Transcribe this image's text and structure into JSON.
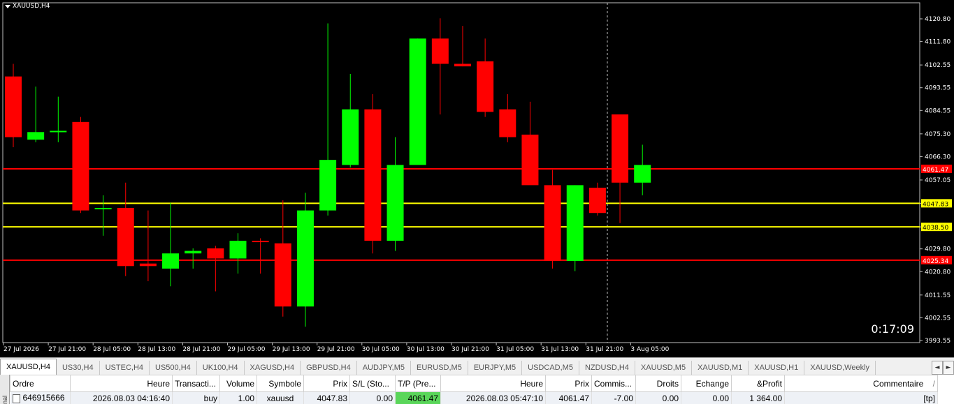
{
  "chart": {
    "symbol": "XAUUSD,H4",
    "timer": "0:17:09",
    "price_axis": [
      "4120.80",
      "4111.80",
      "4102.55",
      "4093.55",
      "4084.55",
      "4075.30",
      "4066.30",
      "4057.05",
      "4047.83",
      "4038.50",
      "4029.80",
      "4020.80",
      "4011.55",
      "4002.55",
      "3993.55"
    ],
    "time_axis": [
      "27 Jul 2026",
      "27 Jul 21:00",
      "28 Jul 05:00",
      "28 Jul 13:00",
      "28 Jul 21:00",
      "29 Jul 05:00",
      "29 Jul 13:00",
      "29 Jul 21:00",
      "30 Jul 05:00",
      "30 Jul 13:00",
      "30 Jul 21:00",
      "31 Jul 05:00",
      "31 Jul 13:00",
      "31 Jul 21:00",
      "3 Aug 05:00"
    ],
    "levels": [
      {
        "price": 4061.47,
        "label": "4061.47",
        "color": "#ff0000"
      },
      {
        "price": 4047.83,
        "label": "4047.83",
        "color": "#ffff00"
      },
      {
        "price": 4038.5,
        "label": "4038.50",
        "color": "#ffff00"
      },
      {
        "price": 4025.34,
        "label": "4025.34",
        "color": "#ff0000"
      }
    ],
    "bull_color": "#00ff00",
    "bear_color": "#ff0000",
    "candles": [
      {
        "o": 4098,
        "h": 4103,
        "l": 4070,
        "c": 4074
      },
      {
        "o": 4073,
        "h": 4094,
        "l": 4072,
        "c": 4076
      },
      {
        "o": 4076,
        "h": 4090,
        "l": 4072,
        "c": 4076.5
      },
      {
        "o": 4080,
        "h": 4082,
        "l": 4044,
        "c": 4045
      },
      {
        "o": 4046,
        "h": 4051,
        "l": 4035,
        "c": 4046
      },
      {
        "o": 4046,
        "h": 4056,
        "l": 4019,
        "c": 4023
      },
      {
        "o": 4024,
        "h": 4045,
        "l": 4017,
        "c": 4023
      },
      {
        "o": 4022,
        "h": 4048,
        "l": 4015,
        "c": 4028
      },
      {
        "o": 4028,
        "h": 4030,
        "l": 4022,
        "c": 4029
      },
      {
        "o": 4030,
        "h": 4031,
        "l": 4013,
        "c": 4026
      },
      {
        "o": 4026,
        "h": 4036,
        "l": 4020,
        "c": 4033
      },
      {
        "o": 4033,
        "h": 4034,
        "l": 4020,
        "c": 4032.5
      },
      {
        "o": 4032,
        "h": 4049,
        "l": 4003,
        "c": 4007
      },
      {
        "o": 4007,
        "h": 4052,
        "l": 3999,
        "c": 4045
      },
      {
        "o": 4045,
        "h": 4119,
        "l": 4043,
        "c": 4065
      },
      {
        "o": 4063,
        "h": 4099,
        "l": 4062,
        "c": 4085
      },
      {
        "o": 4085,
        "h": 4091,
        "l": 4028,
        "c": 4033
      },
      {
        "o": 4033,
        "h": 4074,
        "l": 4029,
        "c": 4063
      },
      {
        "o": 4063,
        "h": 4113,
        "l": 4064,
        "c": 4113
      },
      {
        "o": 4113,
        "h": 4121,
        "l": 4083,
        "c": 4103
      },
      {
        "o": 4103,
        "h": 4118,
        "l": 4102,
        "c": 4102
      },
      {
        "o": 4104,
        "h": 4113,
        "l": 4082,
        "c": 4084
      },
      {
        "o": 4085,
        "h": 4091,
        "l": 4072,
        "c": 4074
      },
      {
        "o": 4075,
        "h": 4088,
        "l": 4062,
        "c": 4055
      },
      {
        "o": 4055,
        "h": 4061,
        "l": 4022,
        "c": 4025
      },
      {
        "o": 4025,
        "h": 4055,
        "l": 4021,
        "c": 4055
      },
      {
        "o": 4054,
        "h": 4056,
        "l": 4043,
        "c": 4044
      },
      {
        "o": 4083,
        "h": 4083,
        "l": 4040,
        "c": 4056
      },
      {
        "o": 4056,
        "h": 4071,
        "l": 4051,
        "c": 4063
      }
    ]
  },
  "tabs": [
    "XAUUSD,H4",
    "US30,H4",
    "USTEC,H4",
    "US500,H4",
    "UK100,H4",
    "XAGUSD,H4",
    "GBPUSD,H4",
    "AUDJPY,M5",
    "EURUSD,M5",
    "EURJPY,M5",
    "USDCAD,M5",
    "NZDUSD,H4",
    "XAUUSD,M5",
    "XAUUSD,M1",
    "XAUUSD,H1",
    "XAUUSD,Weekly"
  ],
  "tab_nav": {
    "left": "◄",
    "right": "►"
  },
  "terminal": {
    "side_label": "nal",
    "headers": [
      "Ordre",
      "Heure",
      "Transacti...",
      "Volume",
      "Symbole",
      "Prix",
      "S/L (Sto...",
      "T/P (Pre...",
      "Heure",
      "Prix",
      "Commis...",
      "Droits",
      "Echange",
      "&Profit",
      "Commentaire"
    ],
    "header_extra": "/",
    "row": [
      "646915666",
      "2026.08.03 04:16:40",
      "buy",
      "1.00",
      "xauusd",
      "4047.83",
      "0.00",
      "4061.47",
      "2026.08.03 05:47:10",
      "4061.47",
      "-7.00",
      "0.00",
      "0.00",
      "1 364.00",
      "[tp]"
    ]
  }
}
